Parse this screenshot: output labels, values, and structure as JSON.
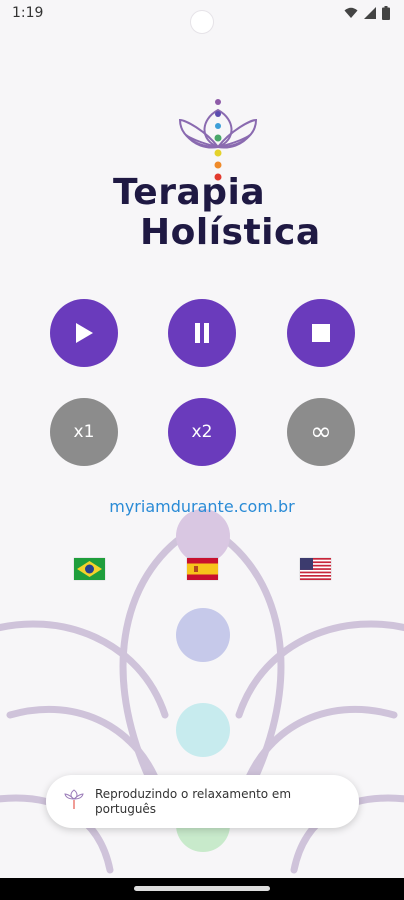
{
  "status": {
    "time": "1:19"
  },
  "brand": {
    "line1": "Terapia",
    "line2": "Holística"
  },
  "controls": {
    "playback": [
      "play",
      "pause",
      "stop"
    ],
    "speed": [
      {
        "label": "x1",
        "active": false
      },
      {
        "label": "x2",
        "active": true
      },
      {
        "label": "∞",
        "active": false
      }
    ]
  },
  "website": {
    "text": "myriamdurante.com.br"
  },
  "languages": [
    {
      "name": "brazil-flag-icon"
    },
    {
      "name": "spain-flag-icon"
    },
    {
      "name": "usa-flag-icon"
    }
  ],
  "toast": {
    "message": "Reproduzindo o relaxamento em português"
  },
  "colors": {
    "accent": "#6a3bbc",
    "inactive": "#8c8c8c",
    "brand_text": "#1f1943",
    "link": "#2a8bd6"
  }
}
